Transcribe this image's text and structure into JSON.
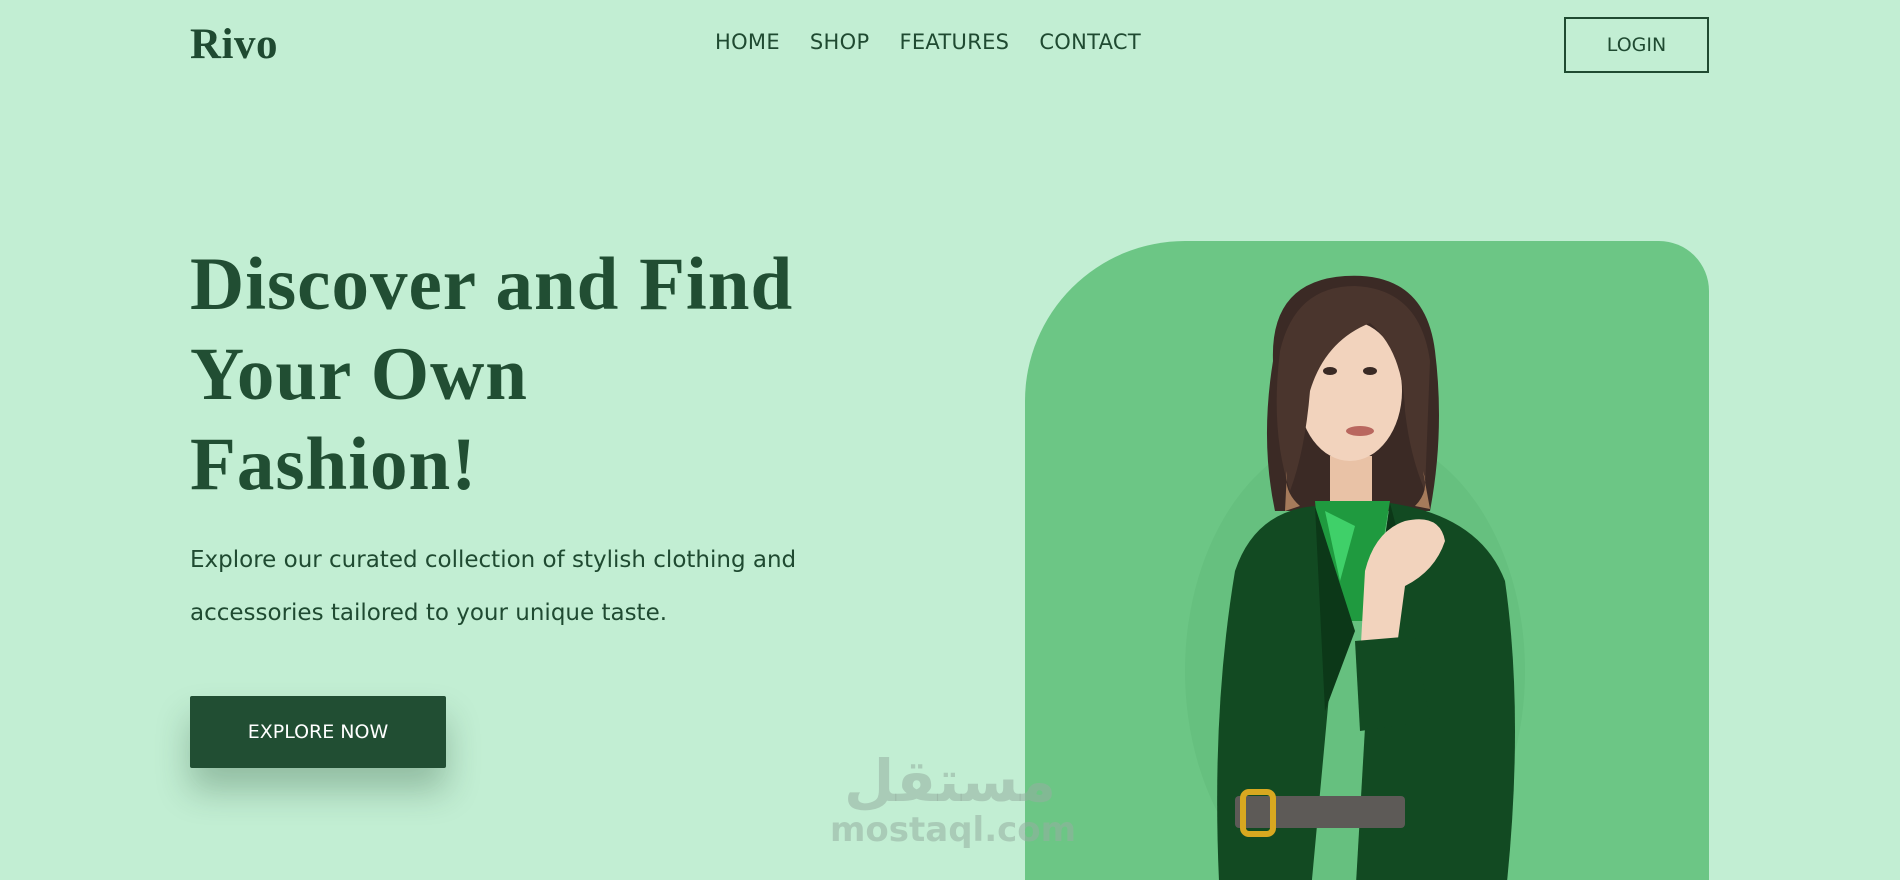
{
  "brand": {
    "logo": "Rivo"
  },
  "nav": {
    "items": [
      "HOME",
      "SHOP",
      "FEATURES",
      "CONTACT"
    ]
  },
  "header": {
    "login_label": "LOGIN"
  },
  "hero": {
    "title_lines": [
      "Discover and Find",
      "Your Own",
      "Fashion!"
    ],
    "description_lines": [
      "Explore our curated collection of stylish clothing and",
      "accessories tailored to your unique taste."
    ],
    "cta_label": "EXPLORE NOW",
    "image_icon": "woman-in-green-suit-photo"
  },
  "watermark": {
    "arabic": "مستقل",
    "latin": "mostaql.com"
  },
  "colors": {
    "background": "#c2eed3",
    "primary": "#214e33",
    "panel": "#6cc685"
  }
}
